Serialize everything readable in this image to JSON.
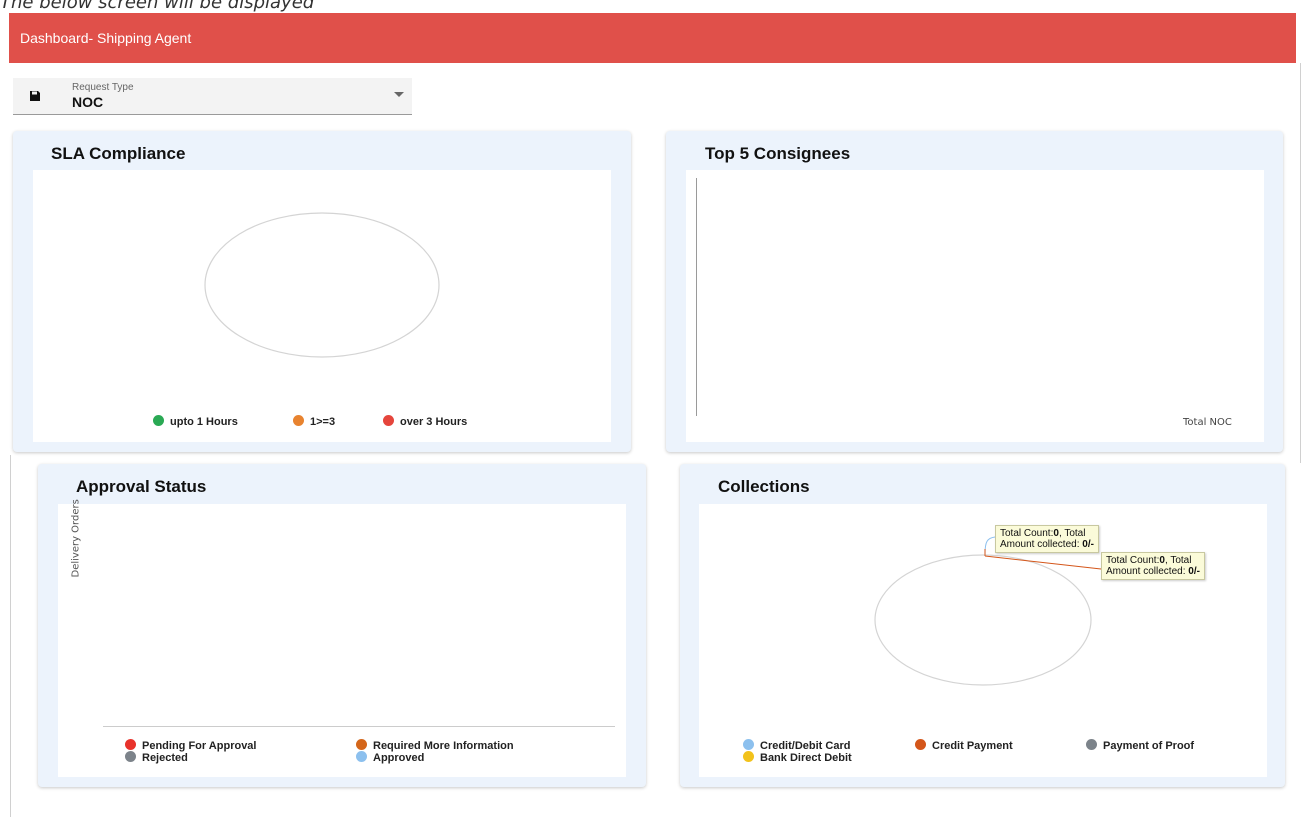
{
  "caption": "The below screen will be displayed",
  "header": {
    "title": "Dashboard- Shipping Agent"
  },
  "request_type": {
    "label": "Request Type",
    "value": "NOC"
  },
  "sla": {
    "title": "SLA Compliance",
    "legend": [
      {
        "label": "upto 1 Hours",
        "color": "#2aa954"
      },
      {
        "label": "1>=3",
        "color": "#e8832f"
      },
      {
        "label": "over 3 Hours",
        "color": "#e5453c"
      }
    ]
  },
  "consignees": {
    "title": "Top 5 Consignees",
    "axis_label": "Total NOC"
  },
  "approval": {
    "title": "Approval Status",
    "y_label": "Delivery Orders",
    "legend": [
      {
        "label": "Pending For Approval",
        "color": "#e8322b"
      },
      {
        "label": "Required More Information",
        "color": "#d4661a"
      },
      {
        "label": "Rejected",
        "color": "#7c838a"
      },
      {
        "label": "Approved",
        "color": "#8cc0ee"
      }
    ]
  },
  "collections": {
    "title": "Collections",
    "tooltips": [
      {
        "prefix": "Total Count:",
        "count": "0",
        "mid": ", Total",
        "line2": "Amount collected: ",
        "amount": "0/-"
      },
      {
        "prefix": "Total Count:",
        "count": "0",
        "mid": ", Total",
        "line2": "Amount collected: ",
        "amount": "0/-"
      }
    ],
    "legend": [
      {
        "label": "Credit/Debit Card",
        "color": "#8cc0ee"
      },
      {
        "label": "Credit Payment",
        "color": "#d4561a"
      },
      {
        "label": "Payment of Proof",
        "color": "#7c838a"
      },
      {
        "label": "Bank Direct Debit",
        "color": "#f2c21b"
      }
    ]
  }
}
